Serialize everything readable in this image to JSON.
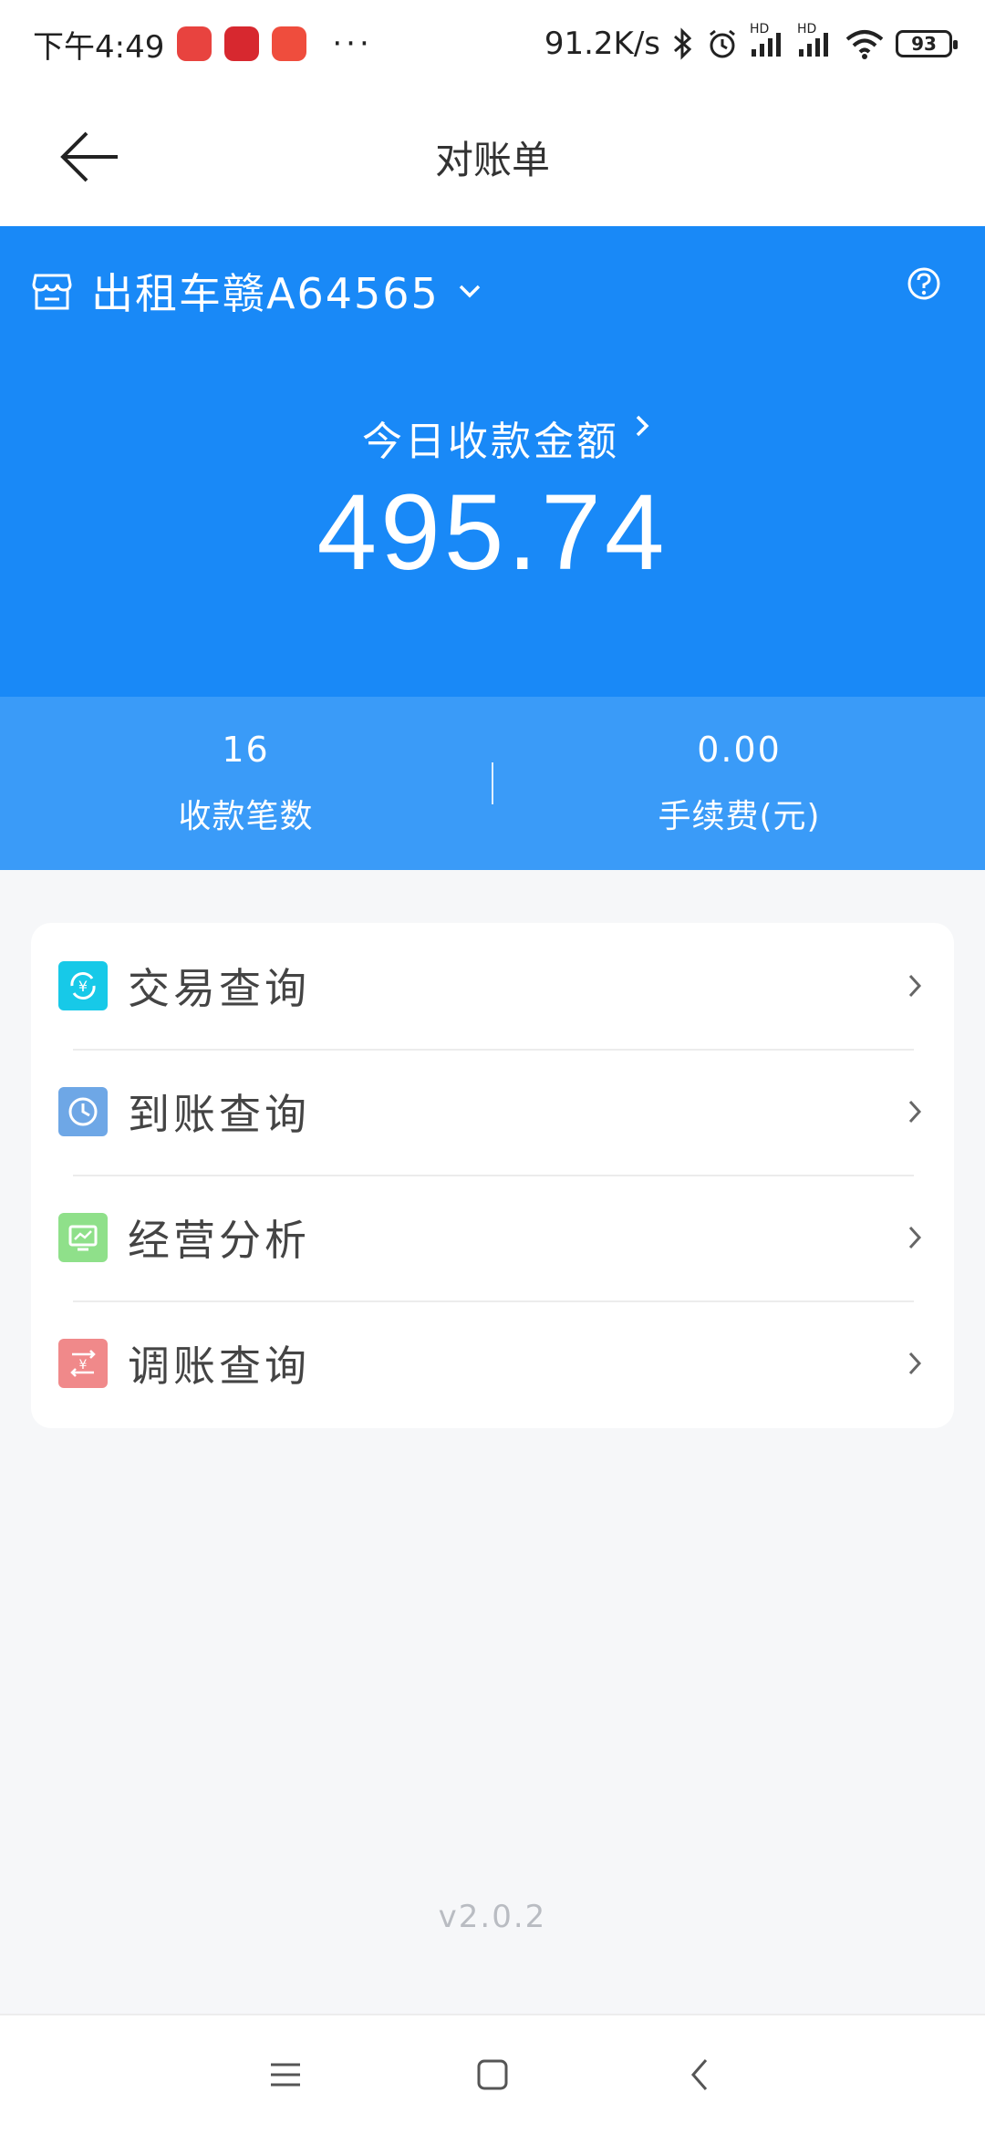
{
  "status_bar": {
    "time": "下午4:49",
    "overflow": "···",
    "net_speed": "91.2K/s",
    "hd1": "HD",
    "hd2": "HD",
    "battery": "93"
  },
  "nav": {
    "title": "对账单"
  },
  "hero": {
    "store_name": "出租车赣A64565",
    "amount_label": "今日收款金额",
    "amount_value": "495.74"
  },
  "stats": [
    {
      "value": "16",
      "label": "收款笔数"
    },
    {
      "value": "0.00",
      "label": "手续费(元)"
    }
  ],
  "menu": [
    {
      "label": "交易查询",
      "icon": "yuan-exchange-icon",
      "color": "#17c9e8"
    },
    {
      "label": "到账查询",
      "icon": "clock-icon",
      "color": "#6ea7e6"
    },
    {
      "label": "经营分析",
      "icon": "monitor-chart-icon",
      "color": "#8fe08a"
    },
    {
      "label": "调账查询",
      "icon": "yuan-adjust-icon",
      "color": "#f0898a"
    }
  ],
  "version": "v2.0.2",
  "colors": {
    "hero_bg": "#1989f7",
    "stats_bg": "#3a9bf8",
    "page_bg": "#f6f7f9"
  }
}
